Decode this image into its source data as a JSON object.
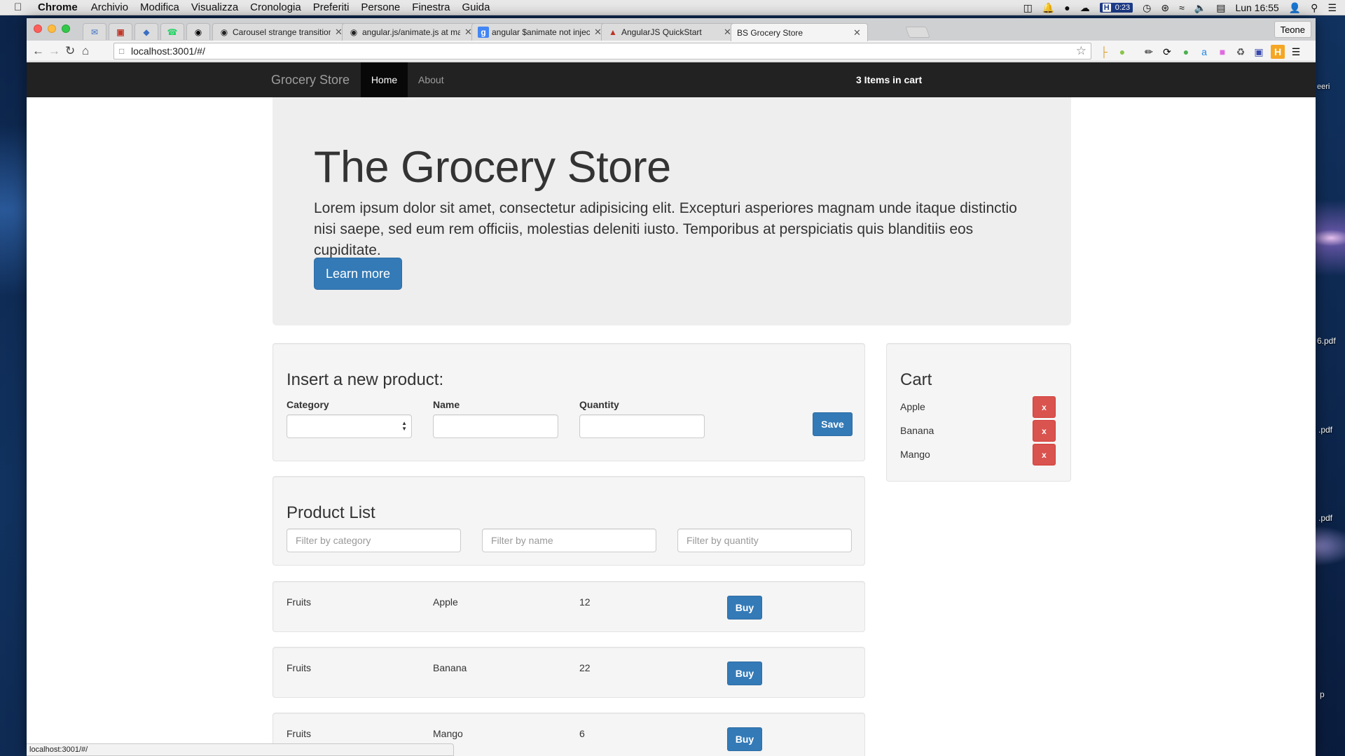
{
  "menubar": {
    "app": "Chrome",
    "items": [
      "Archivio",
      "Modifica",
      "Visualizza",
      "Cronologia",
      "Preferiti",
      "Persone",
      "Finestra",
      "Guida"
    ],
    "timer": "0:23",
    "timer_letter": "H",
    "clock": "Lun 16:55"
  },
  "browser": {
    "profile": "Teone",
    "url": "localhost:3001/#/",
    "status_url": "localhost:3001/#/",
    "tabs": [
      {
        "label": "Carousel strange transition"
      },
      {
        "label": "angular.js/animate.js at ma"
      },
      {
        "label": "angular $animate not injec"
      },
      {
        "label": "AngularJS QuickStart"
      },
      {
        "label": "BS Grocery Store"
      }
    ]
  },
  "navbar": {
    "brand": "Grocery Store",
    "home": "Home",
    "about": "About",
    "cart_count": "3 Items in cart"
  },
  "jumbotron": {
    "title": "The Grocery Store",
    "text": "Lorem ipsum dolor sit amet, consectetur adipisicing elit. Excepturi asperiores magnam unde itaque distinctio nisi saepe, sed eum rem officiis, molestias deleniti iusto. Temporibus at perspiciatis quis blanditiis eos cupiditate.",
    "button": "Learn more"
  },
  "insert_form": {
    "title": "Insert a new product:",
    "category_label": "Category",
    "name_label": "Name",
    "quantity_label": "Quantity",
    "save": "Save"
  },
  "product_list": {
    "title": "Product List",
    "filter_category": "Filter by category",
    "filter_name": "Filter by name",
    "filter_quantity": "Filter by quantity",
    "buy_label": "Buy",
    "rows": [
      {
        "category": "Fruits",
        "name": "Apple",
        "quantity": "12"
      },
      {
        "category": "Fruits",
        "name": "Banana",
        "quantity": "22"
      },
      {
        "category": "Fruits",
        "name": "Mango",
        "quantity": "6"
      }
    ]
  },
  "cart": {
    "title": "Cart",
    "remove_label": "x",
    "items": [
      "Apple",
      "Banana",
      "Mango"
    ]
  },
  "desktop": {
    "labels": [
      "eeri",
      "6.pdf",
      ".pdf",
      ".pdf",
      "p"
    ]
  }
}
